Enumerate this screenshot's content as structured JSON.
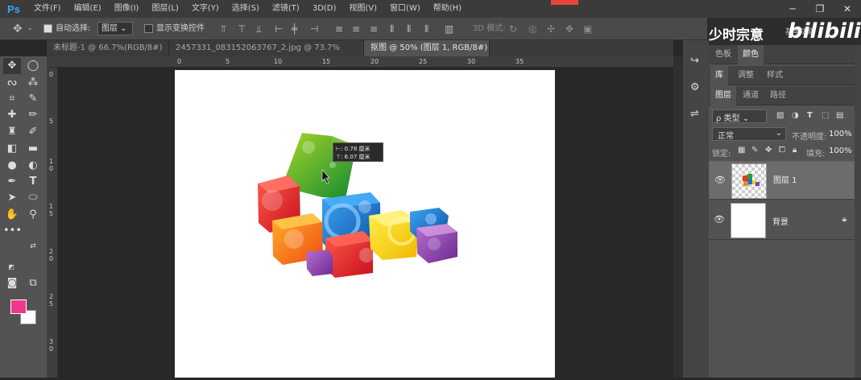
{
  "app": {
    "logo": "Ps"
  },
  "menu": [
    "文件(F)",
    "编辑(E)",
    "图像(I)",
    "图层(L)",
    "文字(Y)",
    "选择(S)",
    "滤镜(T)",
    "3D(D)",
    "视图(V)",
    "窗口(W)",
    "帮助(H)"
  ],
  "options": {
    "auto_select_label": "自动选择:",
    "auto_select_value": "图层",
    "transform_label": "显示变换控件",
    "mode3d_label": "3D 模式:"
  },
  "tabs": [
    {
      "label": "未标题-1 @ 66.7%(RGB/8#)",
      "close": "×",
      "active": false
    },
    {
      "label": "2457331_083152063767_2.jpg @ 73.7%(RGB/8#)",
      "close": "×",
      "active": false
    },
    {
      "label": "抠图 @ 50% (图层 1, RGB/8#) *",
      "close": "×",
      "active": true
    }
  ],
  "ruler": {
    "top": [
      "0",
      "5",
      "10",
      "15",
      "20",
      "25",
      "30",
      "35"
    ],
    "left": [
      "0",
      "5",
      "1 0",
      "1 5",
      "2 0",
      "2 5",
      "3 0"
    ]
  },
  "tooltip": {
    "line1": "⊢: 0.78 厘米",
    "line2": "⊤: 6.07 厘米"
  },
  "watermark": {
    "text": "少时宗意",
    "logo": "bilibili",
    "workspace": "基本功能"
  },
  "panels": {
    "tabs_row1": [
      "色板",
      "颜色"
    ],
    "tabs_row2": [
      "库",
      "调整",
      "样式"
    ],
    "tabs_row3": [
      "图层",
      "通道",
      "路径"
    ],
    "filter_kind": "ρ 类型",
    "blend_mode": "正常",
    "opacity_label": "不透明度:",
    "opacity_value": "100%",
    "lock_label": "锁定:",
    "fill_label": "填充:",
    "fill_value": "100%",
    "layers": [
      {
        "name": "图层 1",
        "selected": true,
        "transparent": true
      },
      {
        "name": "背景",
        "selected": false,
        "transparent": false,
        "locked": true
      }
    ]
  },
  "colors": {
    "foreground": "#ee3a8c",
    "background": "#ffffff",
    "accent": "#31a8ff"
  }
}
